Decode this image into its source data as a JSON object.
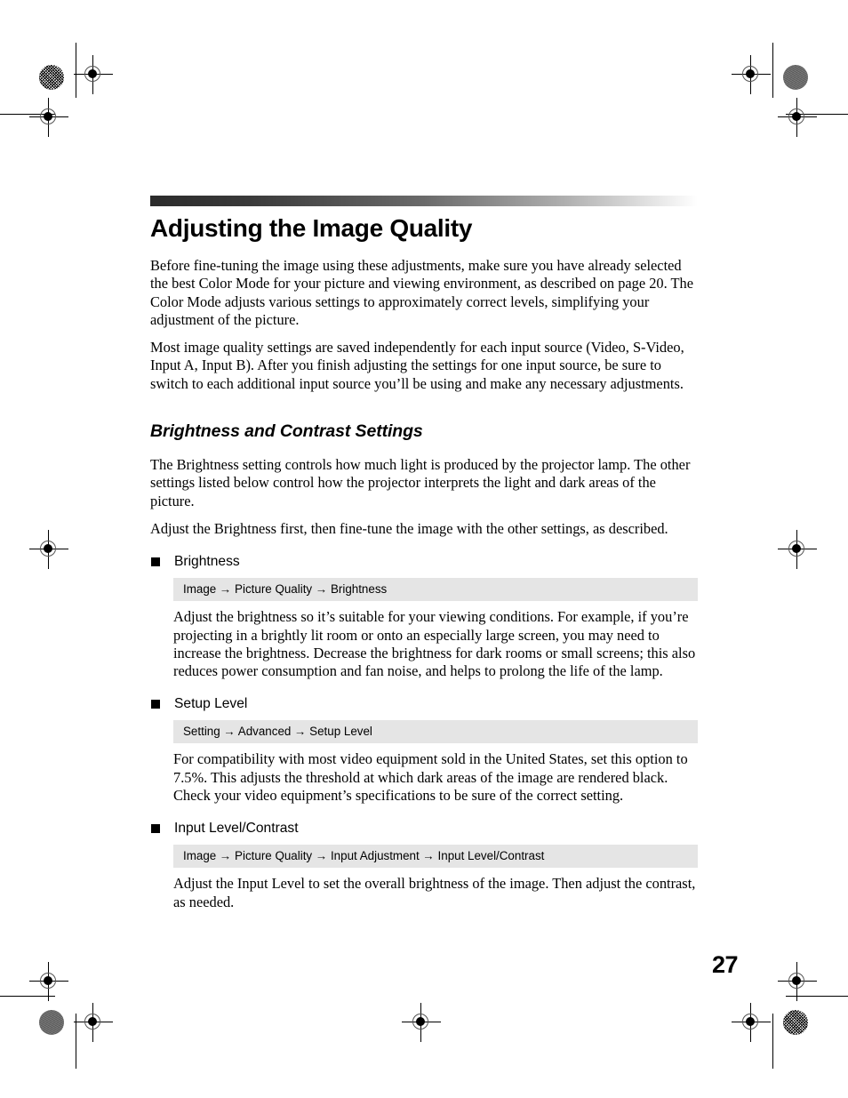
{
  "document": {
    "title": "Adjusting the Image Quality",
    "page_number": "27",
    "section_heading": "Brightness and Contrast Settings",
    "intro_paragraphs": [
      "Before fine-tuning the image using these adjustments, make sure you have already selected the best Color Mode for your picture and viewing environment, as described on page 20. The Color Mode adjusts various settings to approximately correct levels, simplifying your adjustment of the picture.",
      "Most image quality settings are saved independently for each input source (Video, S-Video, Input A, Input B). After you finish adjusting the settings for one input source, be sure to switch to each additional input source you’ll be using and make any necessary adjustments."
    ],
    "section_paragraphs": [
      "The Brightness setting controls how much light is produced by the projector lamp. The other settings listed below control how the projector interprets the light and dark areas of the picture.",
      "Adjust the Brightness first, then fine-tune the image with the other settings, as described."
    ],
    "settings": [
      {
        "label": "Brightness",
        "menu_path": "Image → Picture Quality → Brightness",
        "description": "Adjust the brightness so it’s suitable for your viewing conditions. For example, if you’re projecting in a brightly lit room or onto an especially large screen, you may need to increase the brightness. Decrease the brightness for dark rooms or small screens; this also reduces power consumption and fan noise, and helps to prolong the life of the lamp."
      },
      {
        "label": "Setup Level",
        "menu_path": "Setting → Advanced → Setup Level",
        "description": "For compatibility with most video equipment sold in the United States, set this option to 7.5%. This adjusts the threshold at which dark areas of the image are rendered black. Check your video equipment’s specifications to be sure of the correct setting."
      },
      {
        "label": "Input Level/Contrast",
        "menu_path": "Image → Picture Quality → Input Adjustment → Input Level/Contrast",
        "description": "Adjust the Input Level to set the overall brightness of the image. Then adjust the contrast, as needed."
      }
    ],
    "colors": {
      "menu_path_background": "#e5e5e5",
      "rule_gradient_start": "#2b2b2b",
      "rule_gradient_end": "#ffffff",
      "text": "#000000",
      "page_background": "#ffffff"
    }
  }
}
